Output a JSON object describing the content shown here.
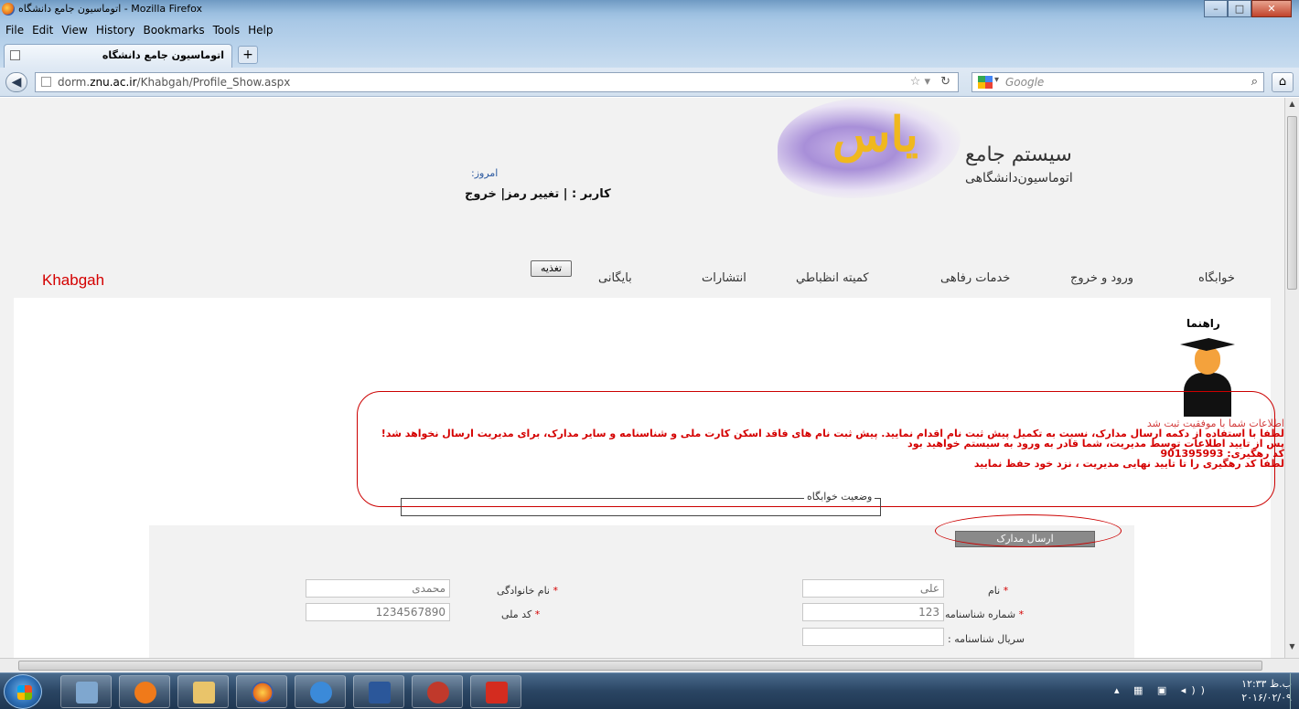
{
  "window": {
    "title": "اتوماسیون جامع دانشگاه - Mozilla Firefox",
    "controls": {
      "minimize": "–",
      "maximize": "□",
      "close": "✕"
    }
  },
  "menu": [
    "File",
    "Edit",
    "View",
    "History",
    "Bookmarks",
    "Tools",
    "Help"
  ],
  "tab": {
    "label": "اتوماسیون جامع دانشگاه",
    "new_tab": "+"
  },
  "address": {
    "url_prefix": "dorm.",
    "url_host": "znu.ac.ir",
    "url_path": "/Khabgah/Profile_Show.aspx"
  },
  "search": {
    "placeholder": "Google"
  },
  "header": {
    "logo_word": "یاس",
    "system_title": "سیستم جامع",
    "system_subtitle": "اتوماسیون‌دانشگاهی",
    "date_label": "امروز:",
    "user_line": "کاربر : | تغییر رمز| خروج"
  },
  "nav": {
    "brand": "Khabgah",
    "items": [
      "خوابگاه",
      "ورود و خروج",
      "خدمات رفاهی",
      "کمیته انظباطي",
      "انتشارات",
      "بایگانی"
    ],
    "food_button": "تغذیه"
  },
  "guide": {
    "label": "راهنما"
  },
  "messages": {
    "success": "اطلاعات شما با موفقیت ثبت شد",
    "line1": "لطفا با استفاده از دکمه ارسال مدارک، نسبت به تکمیل پیش ثبت نام اقدام نمایید. پیش ثبت نام های فاقد اسکن کارت ملی و شناسنامه و سایر مدارک، برای مدیریت ارسال نخواهد شد!",
    "line2": "پس از تایید اطلاعات توسط مدیریت، شما قادر به ورود به سیستم خواهید بود",
    "tracking_label": "کد رهگیری: 901395993",
    "line3": "لطفا کد رهگیری را تا تایید نهایی مدیریت ، نزد خود حفظ نمایید"
  },
  "status_box": {
    "legend": "وضعیت خوابگاه"
  },
  "form": {
    "send_button": "ارسال مدارک",
    "first_name_label": "نام",
    "first_name_value": "علی",
    "last_name_label": "نام خانوادگی",
    "last_name_value": "محمدی",
    "id_number_label": "شماره شناسنامه",
    "id_number_value": "123",
    "national_code_label": "کد ملی",
    "national_code_value": "1234567890",
    "serial_label": "سریال شناسنامه :",
    "serial_value": ""
  },
  "taskbar": {
    "clock_time": "۱۲:۳۳ ب.ظ",
    "clock_date": "۲۰۱۶/۰۲/۰۹"
  },
  "colors": {
    "brand_red": "#d40000",
    "highlight_red": "#cc0000",
    "link_blue": "#2c5aa0"
  }
}
